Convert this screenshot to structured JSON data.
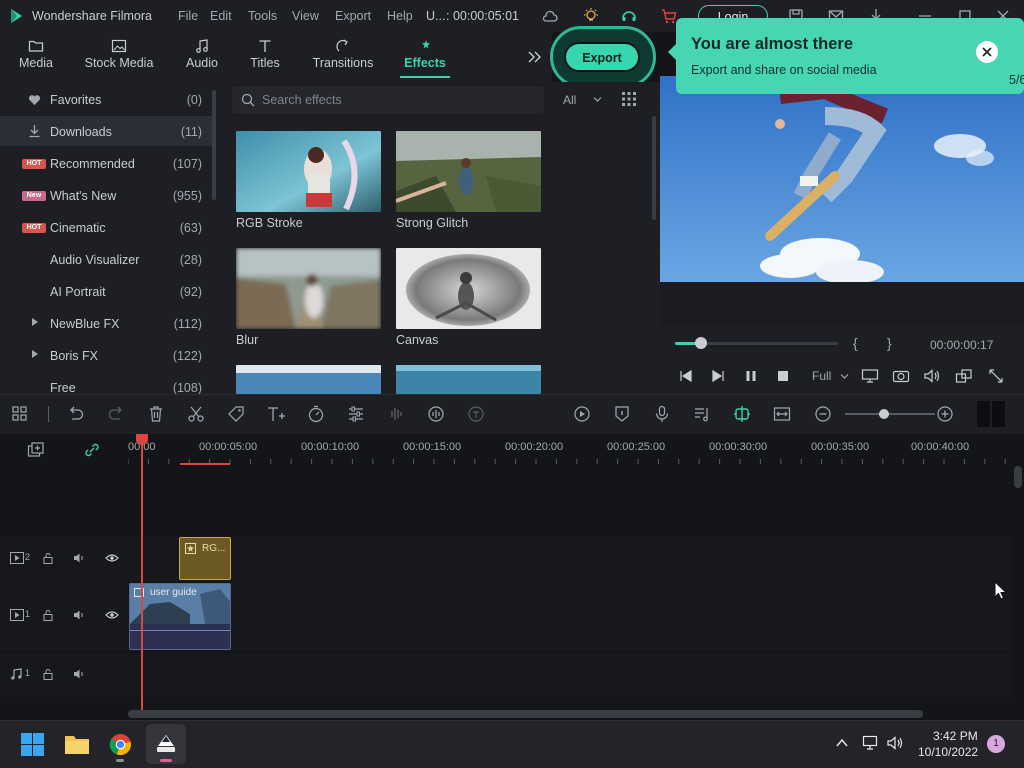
{
  "titlebar": {
    "app_name": "Wondershare Filmora",
    "menu": [
      "File",
      "Edit",
      "Tools",
      "View",
      "Export",
      "Help"
    ],
    "project": "U...",
    "timecode": ": 00:00:05:01",
    "login_label": "Login"
  },
  "tabs": [
    {
      "label": "Media",
      "icon": "folder-icon"
    },
    {
      "label": "Stock Media",
      "icon": "image-icon"
    },
    {
      "label": "Audio",
      "icon": "music-note-icon"
    },
    {
      "label": "Titles",
      "icon": "text-icon"
    },
    {
      "label": "Transitions",
      "icon": "transition-icon"
    },
    {
      "label": "Effects",
      "icon": "effects-icon",
      "active": true
    }
  ],
  "export_button": {
    "label": "Export"
  },
  "tooltip": {
    "title": "You are almost there",
    "subtitle": "Export and share on social media",
    "step": "5/6"
  },
  "sidebar": {
    "items": [
      {
        "label": "Favorites",
        "count": "(0)",
        "icon": "heart-icon"
      },
      {
        "label": "Downloads",
        "count": "(11)",
        "icon": "download-icon",
        "selected": true
      },
      {
        "label": "Recommended",
        "count": "(107)",
        "badge": "HOT"
      },
      {
        "label": "What's New",
        "count": "(955)",
        "badge": "New"
      },
      {
        "label": "Cinematic",
        "count": "(63)",
        "badge": "HOT"
      },
      {
        "label": "Audio Visualizer",
        "count": "(28)"
      },
      {
        "label": "AI Portrait",
        "count": "(92)"
      },
      {
        "label": "NewBlue FX",
        "count": "(112)",
        "expandable": true
      },
      {
        "label": "Boris FX",
        "count": "(122)",
        "expandable": true
      },
      {
        "label": "Free",
        "count": "(108)"
      }
    ]
  },
  "search": {
    "placeholder": "Search effects",
    "filter": "All"
  },
  "effects": [
    {
      "label": "RGB Stroke"
    },
    {
      "label": "Strong Glitch"
    },
    {
      "label": "Blur"
    },
    {
      "label": "Canvas"
    }
  ],
  "preview": {
    "bracket_in": "{",
    "bracket_out": "}",
    "timecode": "00:00:00:17",
    "quality": "Full",
    "progress": 0.16
  },
  "ruler": {
    "labels": [
      "00:00",
      "00:00:05:00",
      "00:00:10:00",
      "00:00:15:00",
      "00:00:20:00",
      "00:00:25:00",
      "00:00:30:00",
      "00:00:35:00",
      "00:00:40:00"
    ]
  },
  "tracks": [
    {
      "id": "2",
      "kind": "video"
    },
    {
      "id": "1",
      "kind": "video"
    },
    {
      "id": "1",
      "kind": "audio"
    }
  ],
  "clips": {
    "effect_clip": "RG...",
    "video_clip": "user guide"
  },
  "taskbar": {
    "time": "3:42 PM",
    "date": "10/10/2022",
    "notification_count": "1"
  },
  "colors": {
    "accent": "#36d6b0",
    "tooltip_bg": "#46d6b4",
    "playhead": "#e0443e",
    "panel_bg": "#1d1f24"
  }
}
